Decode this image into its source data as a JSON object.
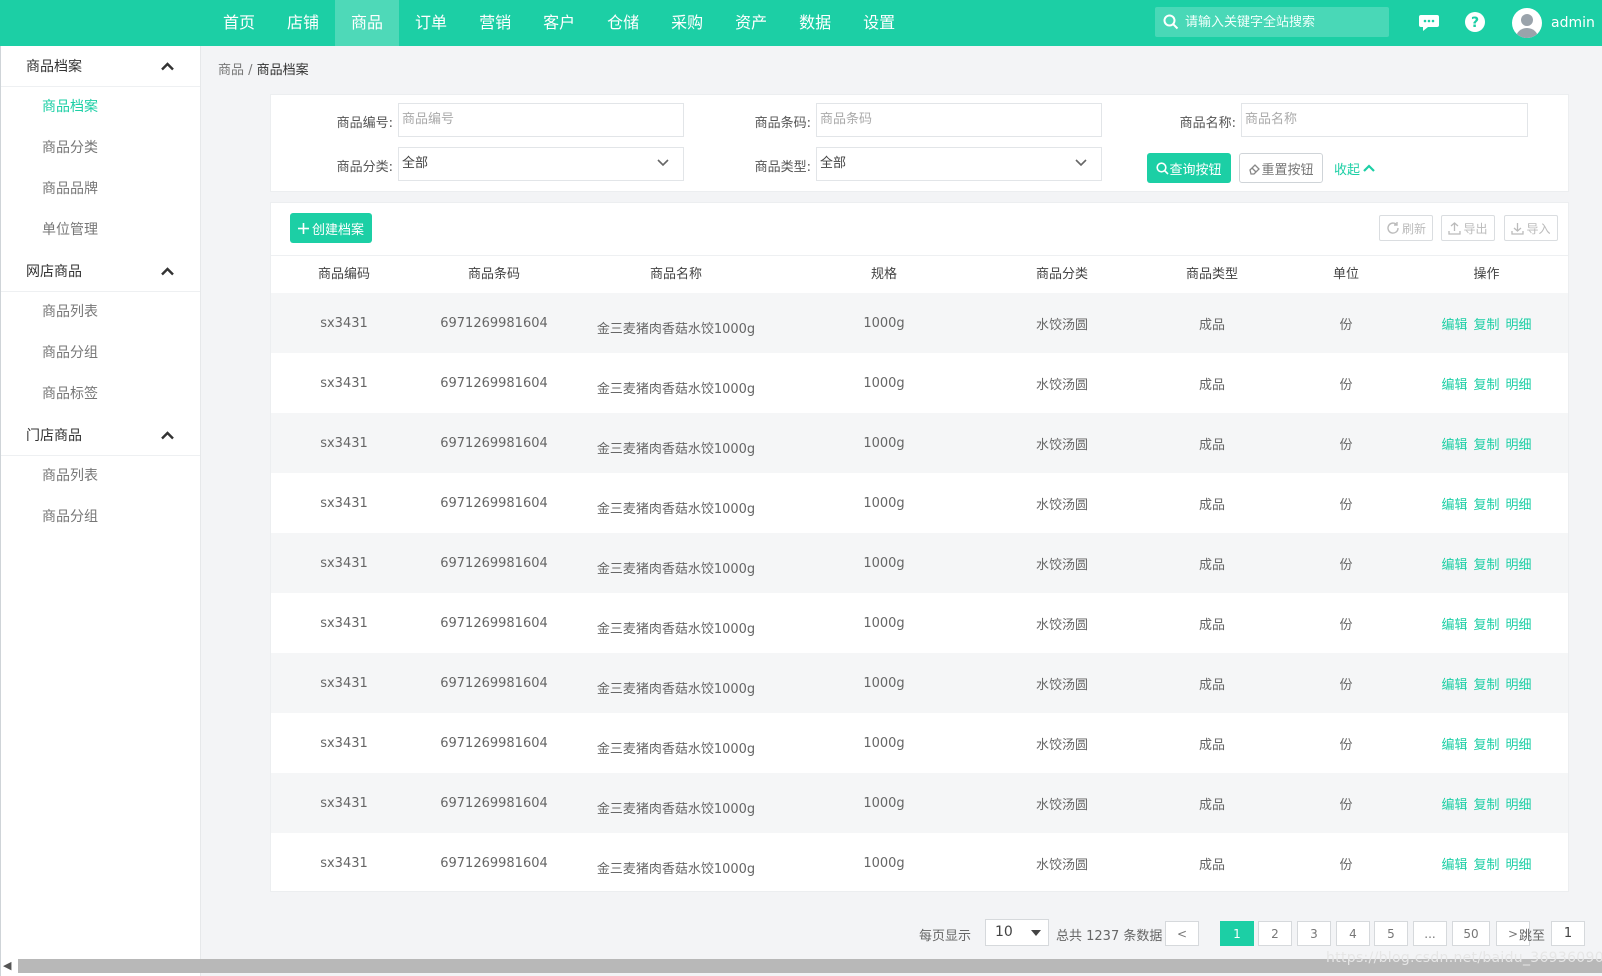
{
  "nav": {
    "items": [
      {
        "label": "首页",
        "active": false
      },
      {
        "label": "店铺",
        "active": false
      },
      {
        "label": "商品",
        "active": true
      },
      {
        "label": "订单",
        "active": false
      },
      {
        "label": "营销",
        "active": false
      },
      {
        "label": "客户",
        "active": false
      },
      {
        "label": "仓储",
        "active": false
      },
      {
        "label": "采购",
        "active": false
      },
      {
        "label": "资产",
        "active": false
      },
      {
        "label": "数据",
        "active": false
      },
      {
        "label": "设置",
        "active": false
      }
    ],
    "search_placeholder": "请输入关键字全站搜索",
    "user": "admin"
  },
  "sidebar": {
    "groups": [
      {
        "title": "商品档案",
        "items": [
          {
            "label": "商品档案",
            "active": true
          },
          {
            "label": "商品分类",
            "active": false
          },
          {
            "label": "商品品牌",
            "active": false
          },
          {
            "label": "单位管理",
            "active": false
          }
        ]
      },
      {
        "title": "网店商品",
        "items": [
          {
            "label": "商品列表",
            "active": false
          },
          {
            "label": "商品分组",
            "active": false
          },
          {
            "label": "商品标签",
            "active": false
          }
        ]
      },
      {
        "title": "门店商品",
        "items": [
          {
            "label": "商品列表",
            "active": false
          },
          {
            "label": "商品分组",
            "active": false
          }
        ]
      }
    ]
  },
  "breadcrumb": {
    "parent": "商品",
    "sep": " / ",
    "current": "商品档案"
  },
  "filter": {
    "code_label": "商品编号:",
    "code_placeholder": "商品编号",
    "barcode_label": "商品条码:",
    "barcode_placeholder": "商品条码",
    "name_label": "商品名称:",
    "name_placeholder": "商品名称",
    "category_label": "商品分类:",
    "category_value": "全部",
    "type_label": "商品类型:",
    "type_value": "全部",
    "query_button": "查询按钮",
    "reset_button": "重置按钮",
    "collapse": "收起"
  },
  "toolbar": {
    "create_button": "创建档案",
    "refresh": "刷新",
    "export": "导出",
    "import": "导入"
  },
  "table": {
    "columns": [
      "商品编码",
      "商品条码",
      "商品名称",
      "规格",
      "商品分类",
      "商品类型",
      "单位",
      "操作"
    ],
    "rows": [
      {
        "code": "sx3431",
        "barcode": "6971269981604",
        "name": "金三麦猪肉香菇水饺1000g",
        "spec": "1000g",
        "category": "水饺汤圆",
        "type": "成品",
        "unit": "份"
      },
      {
        "code": "sx3431",
        "barcode": "6971269981604",
        "name": "金三麦猪肉香菇水饺1000g",
        "spec": "1000g",
        "category": "水饺汤圆",
        "type": "成品",
        "unit": "份"
      },
      {
        "code": "sx3431",
        "barcode": "6971269981604",
        "name": "金三麦猪肉香菇水饺1000g",
        "spec": "1000g",
        "category": "水饺汤圆",
        "type": "成品",
        "unit": "份"
      },
      {
        "code": "sx3431",
        "barcode": "6971269981604",
        "name": "金三麦猪肉香菇水饺1000g",
        "spec": "1000g",
        "category": "水饺汤圆",
        "type": "成品",
        "unit": "份"
      },
      {
        "code": "sx3431",
        "barcode": "6971269981604",
        "name": "金三麦猪肉香菇水饺1000g",
        "spec": "1000g",
        "category": "水饺汤圆",
        "type": "成品",
        "unit": "份"
      },
      {
        "code": "sx3431",
        "barcode": "6971269981604",
        "name": "金三麦猪肉香菇水饺1000g",
        "spec": "1000g",
        "category": "水饺汤圆",
        "type": "成品",
        "unit": "份"
      },
      {
        "code": "sx3431",
        "barcode": "6971269981604",
        "name": "金三麦猪肉香菇水饺1000g",
        "spec": "1000g",
        "category": "水饺汤圆",
        "type": "成品",
        "unit": "份"
      },
      {
        "code": "sx3431",
        "barcode": "6971269981604",
        "name": "金三麦猪肉香菇水饺1000g",
        "spec": "1000g",
        "category": "水饺汤圆",
        "type": "成品",
        "unit": "份"
      },
      {
        "code": "sx3431",
        "barcode": "6971269981604",
        "name": "金三麦猪肉香菇水饺1000g",
        "spec": "1000g",
        "category": "水饺汤圆",
        "type": "成品",
        "unit": "份"
      },
      {
        "code": "sx3431",
        "barcode": "6971269981604",
        "name": "金三麦猪肉香菇水饺1000g",
        "spec": "1000g",
        "category": "水饺汤圆",
        "type": "成品",
        "unit": "份"
      }
    ],
    "actions": [
      "编辑",
      "复制",
      "明细"
    ]
  },
  "pagination": {
    "per_page_label": "每页显示",
    "per_page_value": "10",
    "total_label": "总共 1237 条数据",
    "pages": [
      "1",
      "2",
      "3",
      "4",
      "5",
      "...",
      "50"
    ],
    "current_page": "1",
    "prev": "<",
    "next": ">",
    "jump_label": "跳至",
    "jump_value": "1"
  },
  "watermark": "https://blog.csdn.net/baidu_36936090",
  "colors": {
    "accent": "#1ccfa5",
    "nav_active": "#4ed9b8"
  }
}
